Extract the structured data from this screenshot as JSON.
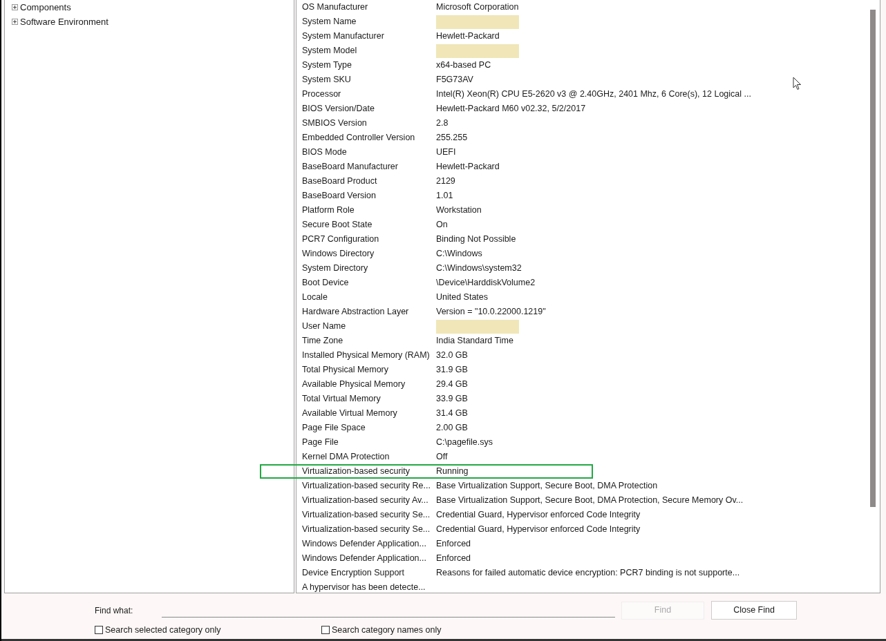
{
  "tree": [
    {
      "label": "Components",
      "expanded": false
    },
    {
      "label": "Software Environment",
      "expanded": false
    }
  ],
  "table": {
    "rows": [
      {
        "item": "OS Manufacturer",
        "kind": "text",
        "value": "Microsoft Corporation",
        "highlighted": false
      },
      {
        "item": "System Name",
        "kind": "redacted",
        "highlighted": false
      },
      {
        "item": "System Manufacturer",
        "kind": "text",
        "value": "Hewlett-Packard",
        "highlighted": false
      },
      {
        "item": "System Model",
        "kind": "redacted",
        "highlighted": false
      },
      {
        "item": "System Type",
        "kind": "text",
        "value": "x64-based PC",
        "highlighted": false
      },
      {
        "item": "System SKU",
        "kind": "text",
        "value": "F5G73AV",
        "highlighted": false
      },
      {
        "item": "Processor",
        "kind": "text",
        "value": "Intel(R) Xeon(R) CPU E5-2620 v3 @ 2.40GHz, 2401 Mhz, 6 Core(s), 12 Logical ...",
        "highlighted": false
      },
      {
        "item": "BIOS Version/Date",
        "kind": "text",
        "value": "Hewlett-Packard M60 v02.32, 5/2/2017",
        "highlighted": false
      },
      {
        "item": "SMBIOS Version",
        "kind": "text",
        "value": "2.8",
        "highlighted": false
      },
      {
        "item": "Embedded Controller Version",
        "kind": "text",
        "value": "255.255",
        "highlighted": false
      },
      {
        "item": "BIOS Mode",
        "kind": "text",
        "value": "UEFI",
        "highlighted": false
      },
      {
        "item": "BaseBoard Manufacturer",
        "kind": "text",
        "value": "Hewlett-Packard",
        "highlighted": false
      },
      {
        "item": "BaseBoard Product",
        "kind": "text",
        "value": "2129",
        "highlighted": false
      },
      {
        "item": "BaseBoard Version",
        "kind": "text",
        "value": "1.01",
        "highlighted": false
      },
      {
        "item": "Platform Role",
        "kind": "text",
        "value": "Workstation",
        "highlighted": false
      },
      {
        "item": "Secure Boot State",
        "kind": "text",
        "value": "On",
        "highlighted": false
      },
      {
        "item": "PCR7 Configuration",
        "kind": "text",
        "value": "Binding Not Possible",
        "highlighted": false
      },
      {
        "item": "Windows Directory",
        "kind": "text",
        "value": "C:\\Windows",
        "highlighted": false
      },
      {
        "item": "System Directory",
        "kind": "text",
        "value": "C:\\Windows\\system32",
        "highlighted": false
      },
      {
        "item": "Boot Device",
        "kind": "text",
        "value": "\\Device\\HarddiskVolume2",
        "highlighted": false
      },
      {
        "item": "Locale",
        "kind": "text",
        "value": "United States",
        "highlighted": false
      },
      {
        "item": "Hardware Abstraction Layer",
        "kind": "text",
        "value": "Version = \"10.0.22000.1219\"",
        "highlighted": false
      },
      {
        "item": "User Name",
        "kind": "redacted",
        "highlighted": false
      },
      {
        "item": "Time Zone",
        "kind": "text",
        "value": "India Standard Time",
        "highlighted": false
      },
      {
        "item": "Installed Physical Memory (RAM)",
        "kind": "text",
        "value": "32.0 GB",
        "highlighted": false
      },
      {
        "item": "Total Physical Memory",
        "kind": "text",
        "value": "31.9 GB",
        "highlighted": false
      },
      {
        "item": "Available Physical Memory",
        "kind": "text",
        "value": "29.4 GB",
        "highlighted": false
      },
      {
        "item": "Total Virtual Memory",
        "kind": "text",
        "value": "33.9 GB",
        "highlighted": false
      },
      {
        "item": "Available Virtual Memory",
        "kind": "text",
        "value": "31.4 GB",
        "highlighted": false
      },
      {
        "item": "Page File Space",
        "kind": "text",
        "value": "2.00 GB",
        "highlighted": false
      },
      {
        "item": "Page File",
        "kind": "text",
        "value": "C:\\pagefile.sys",
        "highlighted": false
      },
      {
        "item": "Kernel DMA Protection",
        "kind": "text",
        "value": "Off",
        "highlighted": false
      },
      {
        "item": "Virtualization-based security",
        "kind": "text",
        "value": "Running",
        "highlighted": true
      },
      {
        "item": "Virtualization-based security Re...",
        "kind": "text",
        "value": "Base Virtualization Support, Secure Boot, DMA Protection",
        "highlighted": false
      },
      {
        "item": "Virtualization-based security Av...",
        "kind": "text",
        "value": "Base Virtualization Support, Secure Boot, DMA Protection, Secure Memory Ov...",
        "highlighted": false
      },
      {
        "item": "Virtualization-based security Se...",
        "kind": "text",
        "value": "Credential Guard, Hypervisor enforced Code Integrity",
        "highlighted": false
      },
      {
        "item": "Virtualization-based security Se...",
        "kind": "text",
        "value": "Credential Guard, Hypervisor enforced Code Integrity",
        "highlighted": false
      },
      {
        "item": "Windows Defender Application...",
        "kind": "text",
        "value": "Enforced",
        "highlighted": false
      },
      {
        "item": "Windows Defender Application...",
        "kind": "text",
        "value": "Enforced",
        "highlighted": false
      },
      {
        "item": "Device Encryption Support",
        "kind": "text",
        "value": "Reasons for failed automatic device encryption: PCR7 binding is not supporte...",
        "highlighted": false
      },
      {
        "item": "A hypervisor has been detecte...",
        "kind": "empty",
        "highlighted": false
      }
    ]
  },
  "find": {
    "label": "Find what:",
    "find_button": {
      "label": "Find",
      "disabled": true
    },
    "close_button": "Close Find",
    "options": [
      {
        "label": "Search selected category only",
        "checked": false
      },
      {
        "label": "Search category names only",
        "checked": false
      }
    ]
  }
}
